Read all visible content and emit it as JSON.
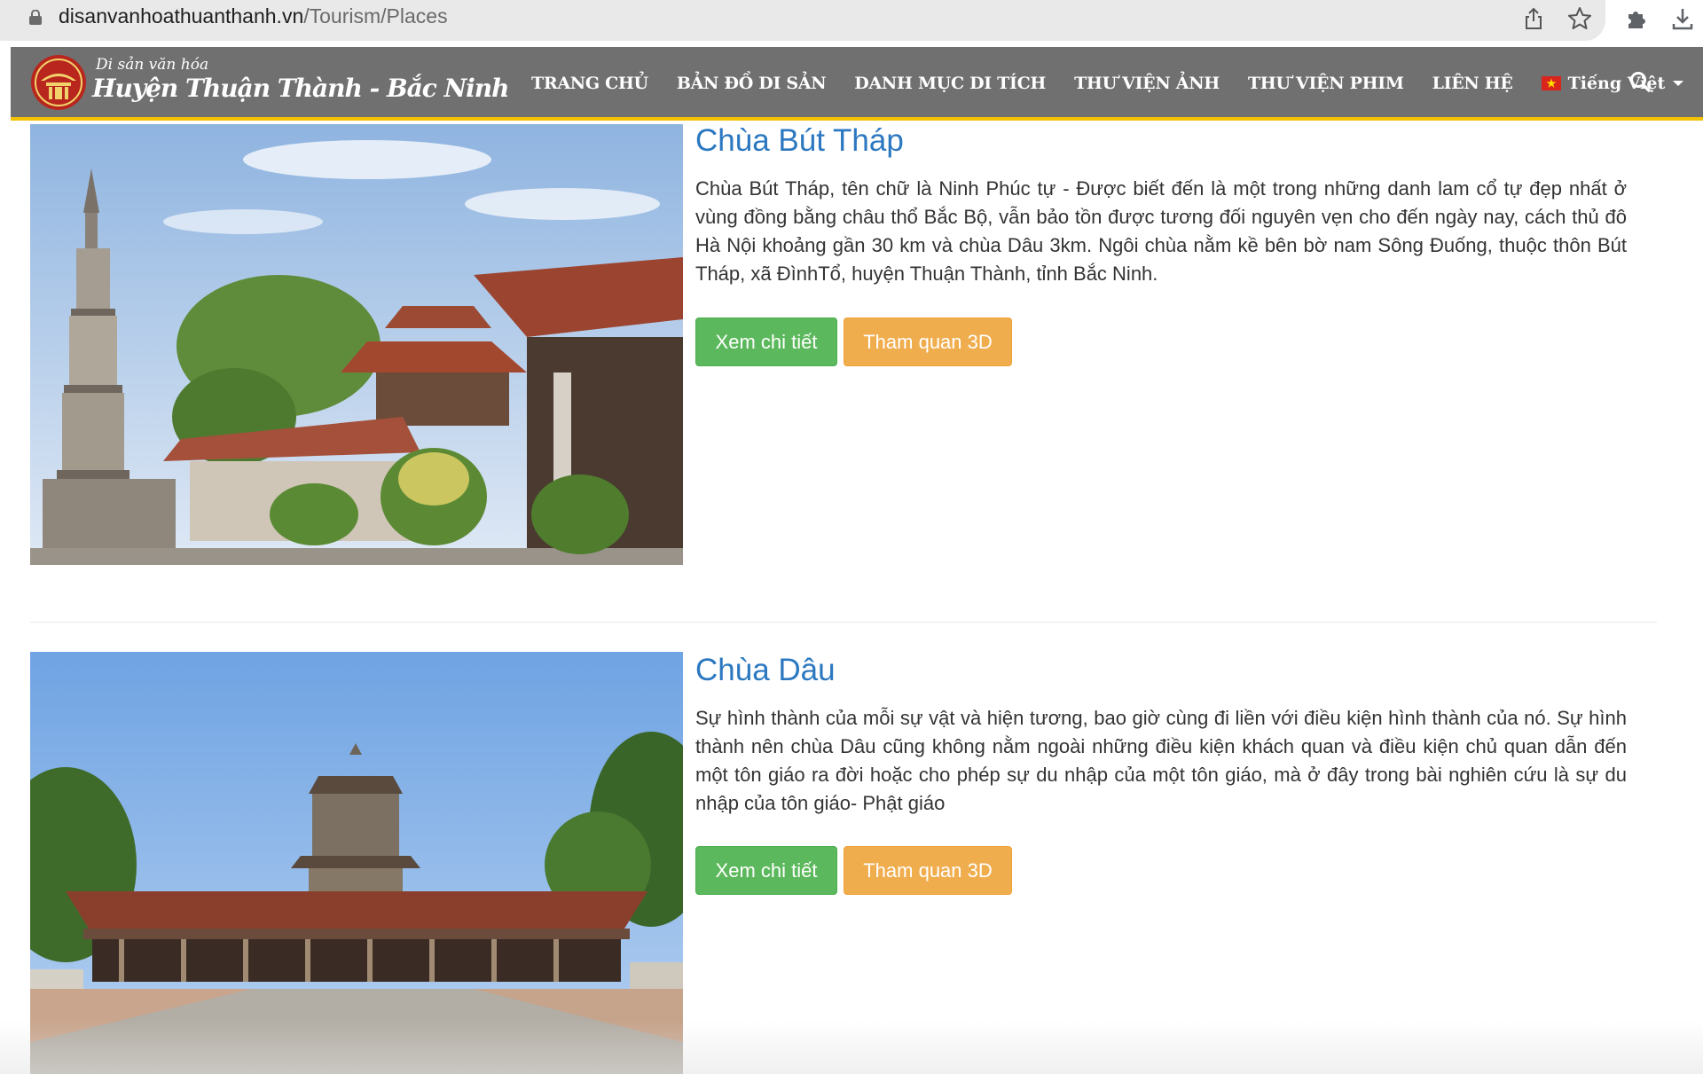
{
  "browser": {
    "url_domain": "disanvanhoathuanthanh.vn",
    "url_path": "/Tourism/Places",
    "icons": [
      "lock-icon",
      "share-icon",
      "star-icon",
      "extensions-icon",
      "download-icon"
    ]
  },
  "header": {
    "logo_small": "Di sản văn hóa",
    "logo_big": "Huyện Thuận Thành - Bắc Ninh",
    "nav": [
      "TRANG CHỦ",
      "BẢN ĐỒ DI SẢN",
      "DANH MỤC DI TÍCH",
      "THƯ VIỆN ẢNH",
      "THƯ VIỆN PHIM",
      "LIÊN HỆ"
    ],
    "language": "Tiếng Việt",
    "colors": {
      "header_bg": "#707070",
      "accent": "#f2c200"
    }
  },
  "places": [
    {
      "title": "Chùa Bút Tháp",
      "description": "Chùa Bút Tháp, tên chữ là Ninh Phúc tự - Được biết đến là một trong những danh lam cổ tự đẹp nhất ở vùng đồng bằng châu thổ Bắc Bộ, vẫn bảo tồn được tương đối nguyên vẹn cho đến ngày nay, cách thủ đô Hà Nội khoảng gần 30 km và chùa Dâu 3km. Ngôi chùa nằm kề bên bờ nam Sông Đuống, thuộc thôn Bút Tháp, xã ĐìnhTổ, huyện Thuận Thành, tỉnh Bắc Ninh.",
      "detail_button": "Xem chi tiết",
      "tour_button": "Tham quan 3D"
    },
    {
      "title": "Chùa Dâu",
      "description": "Sự hình thành của mỗi sự vật và hiện tương, bao giờ cùng đi liền với điều kiện hình thành của nó. Sự hình thành nên chùa Dâu cũng không nằm ngoài những điều kiện khách quan và điều kiện chủ quan dẫn đến một tôn giáo ra đời hoặc cho phép sự du nhập của một tôn giáo, mà ở đây trong bài nghiên cứu là sự du nhập của tôn giáo- Phật giáo",
      "detail_button": "Xem chi tiết",
      "tour_button": "Tham quan 3D"
    }
  ],
  "colors": {
    "title": "#2c78c0",
    "detail_button": "#5cb85c",
    "tour_button": "#f0ad4e"
  }
}
